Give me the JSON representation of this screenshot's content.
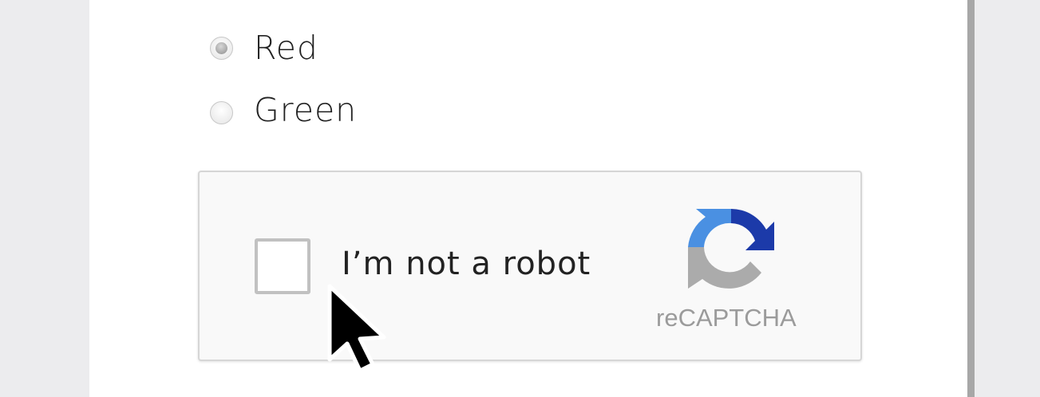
{
  "form": {
    "options": [
      {
        "label": "Red",
        "selected": true
      },
      {
        "label": "Green",
        "selected": false
      }
    ]
  },
  "recaptcha": {
    "checkbox_label": "I’m not a robot",
    "checked": false,
    "brand": "reCAPTCHA",
    "logo_colors": {
      "light_blue": "#4a90e2",
      "dark_blue": "#1c3aa9",
      "gray": "#ababab"
    }
  },
  "cursor": {
    "icon": "arrow-pointer-icon"
  }
}
